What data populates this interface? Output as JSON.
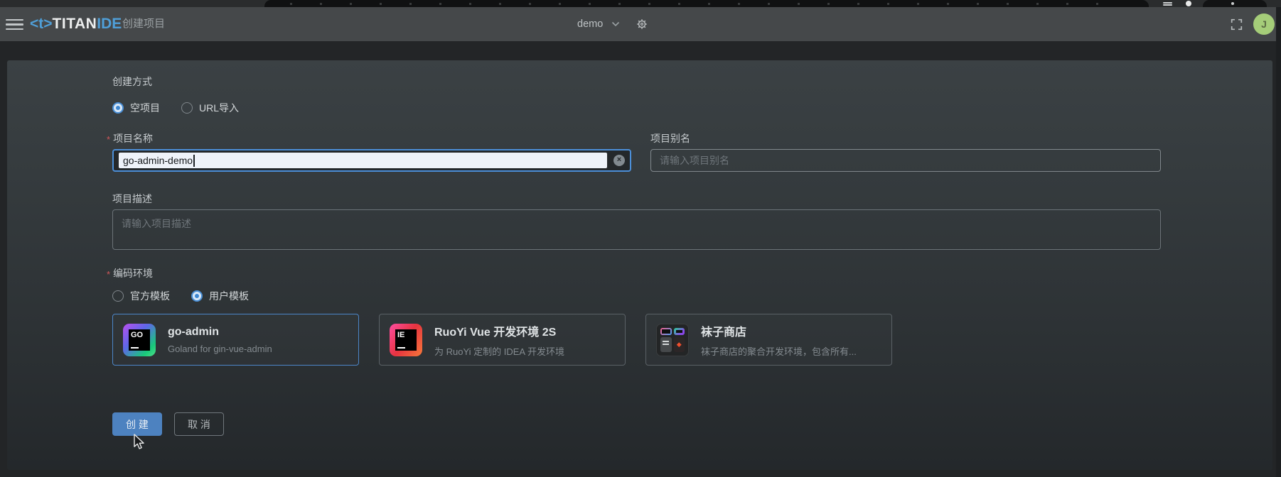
{
  "app": {
    "logo_prefix": "<t>",
    "logo_main": "TITAN",
    "logo_accent": "IDE",
    "page_title": "创建项目",
    "workspace": "demo",
    "avatar_initial": "J"
  },
  "icons": {
    "clear_icon": "×",
    "gem_icon": "◆"
  },
  "form": {
    "required_mark": "*",
    "creation_method": {
      "label": "创建方式",
      "options": [
        {
          "label": "空项目",
          "selected": true
        },
        {
          "label": "URL导入",
          "selected": false
        }
      ]
    },
    "project_name": {
      "label": "项目名称",
      "required": true,
      "value": "go-admin-demo"
    },
    "project_alias": {
      "label": "项目别名",
      "placeholder": "请输入项目别名"
    },
    "project_description": {
      "label": "项目描述",
      "placeholder": "请输入项目描述"
    },
    "environment": {
      "label": "编码环境",
      "required": true,
      "options": [
        {
          "label": "官方模板",
          "selected": false
        },
        {
          "label": "用户模板",
          "selected": true
        }
      ]
    },
    "templates": [
      {
        "title": "go-admin",
        "subtitle": "Goland for gin-vue-admin",
        "icon_text": "GO",
        "selected": true
      },
      {
        "title": "RuoYi Vue 开发环境 2S",
        "subtitle": "为 RuoYi 定制的 IDEA 开发环境",
        "icon_text": "IE",
        "selected": false
      },
      {
        "title": "袜子商店",
        "subtitle": "袜子商店的聚合开发环境，包含所有...",
        "icon_text": "",
        "selected": false
      }
    ],
    "actions": {
      "create": "创 建",
      "cancel": "取 消"
    }
  },
  "colors": {
    "accent_blue": "#4a8fd6",
    "selected_card_border": "#4c86c8",
    "create_button_bg": "#4d82c0",
    "header_bg": "#45484a",
    "panel_bg_top": "#3b4144",
    "avatar_bg": "#a5cd79",
    "required_red": "#cf5659"
  }
}
